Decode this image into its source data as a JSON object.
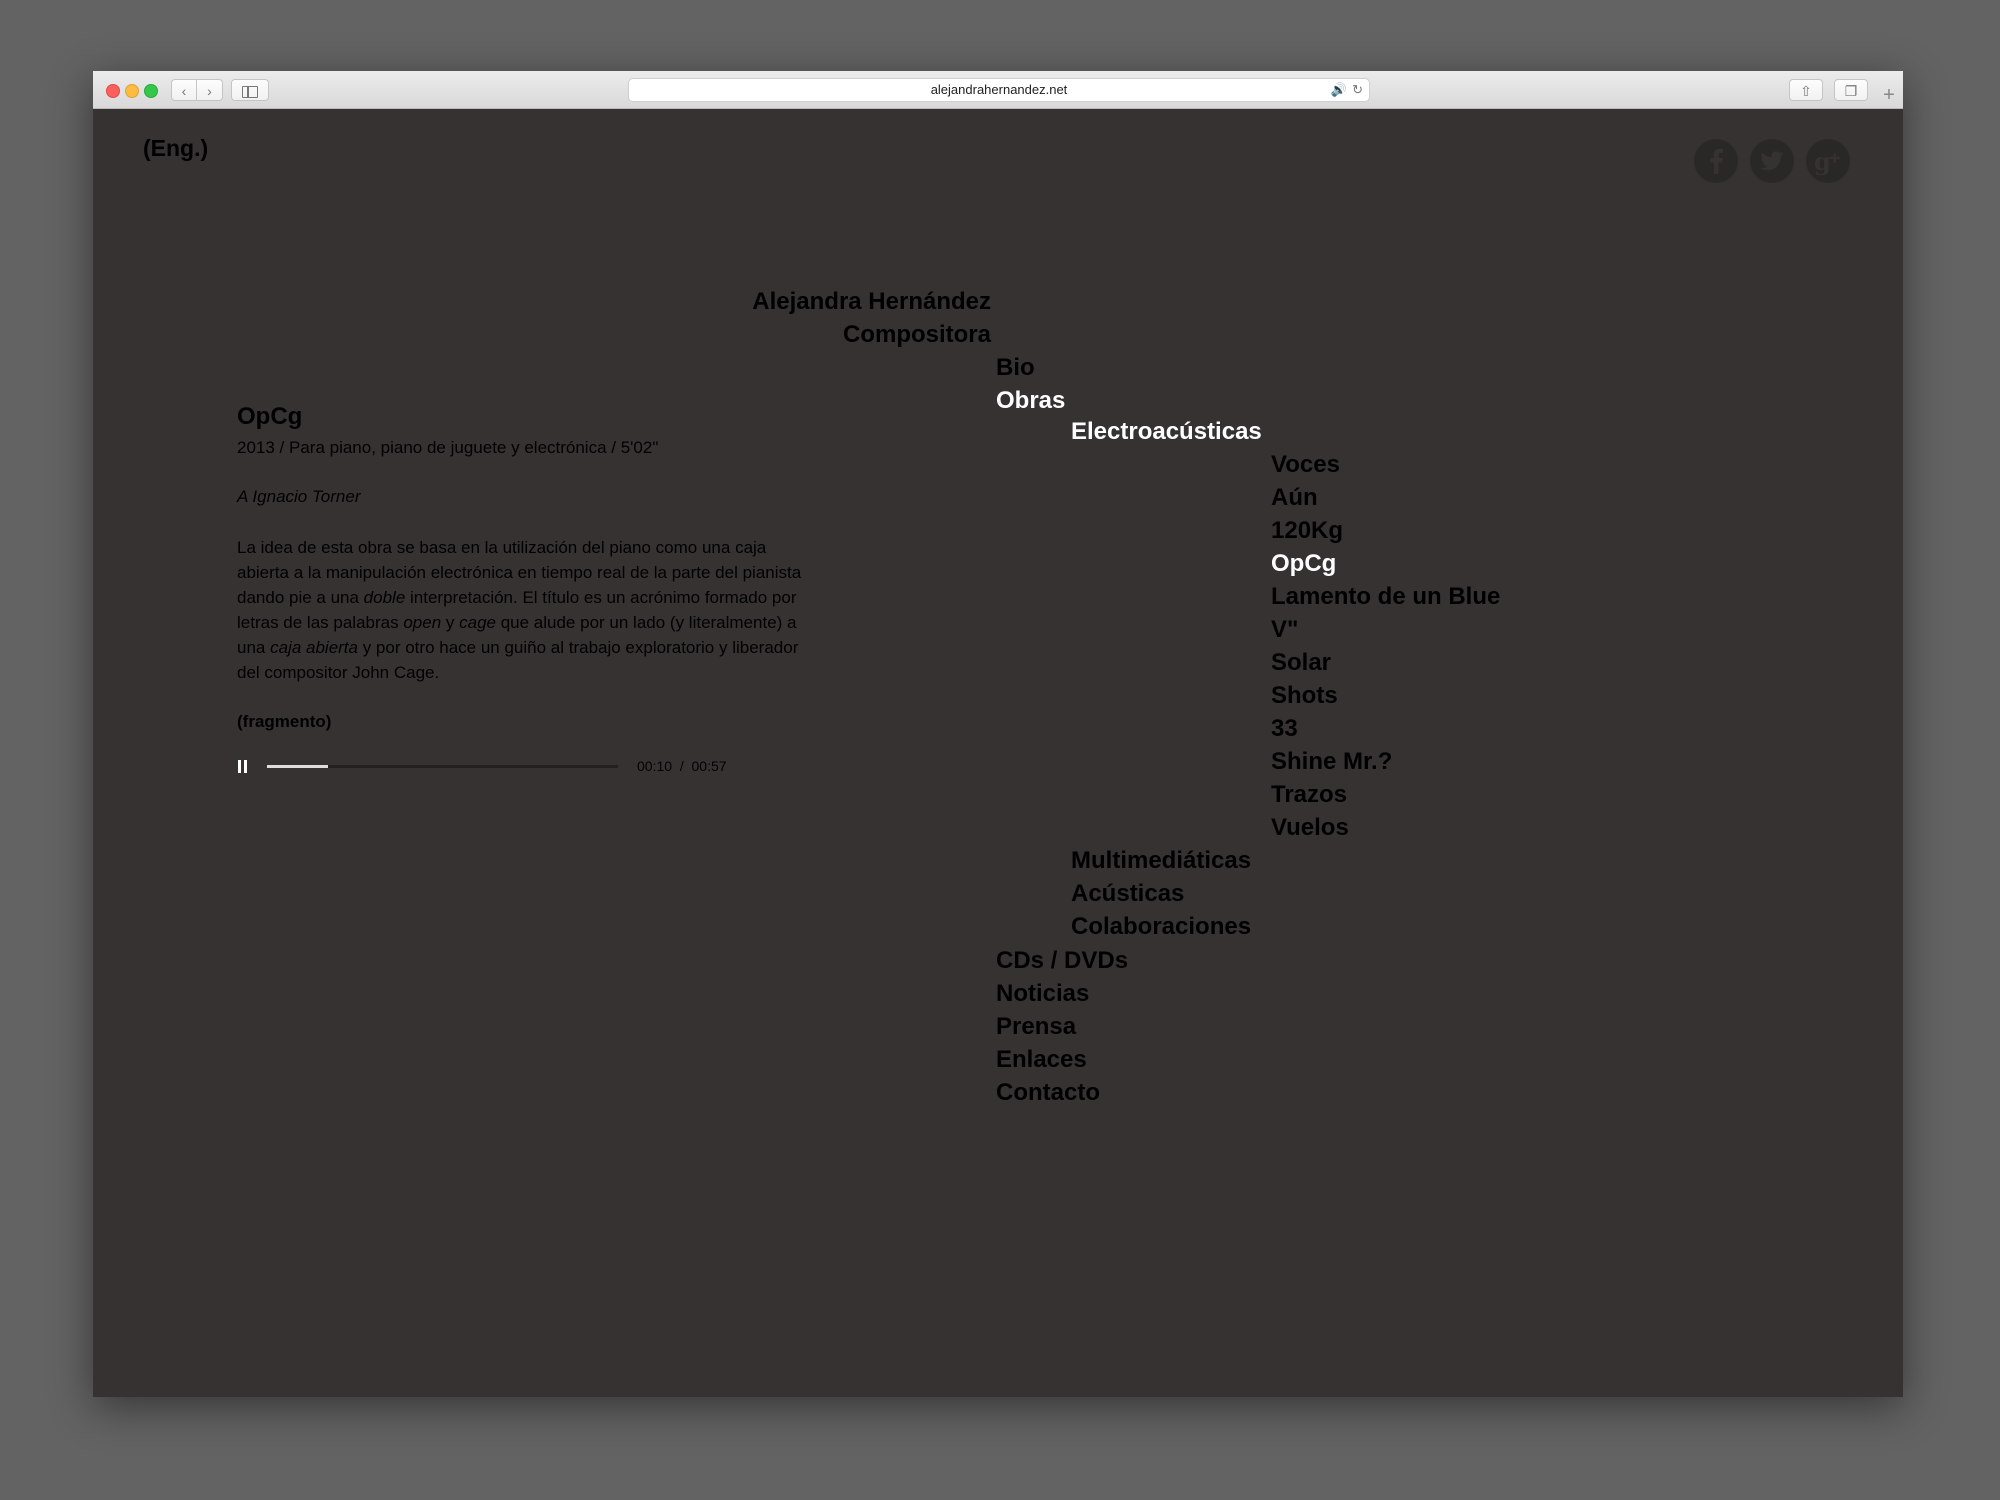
{
  "browser": {
    "url": "alejandrahernandez.net",
    "back_glyph": "‹",
    "forward_glyph": "›",
    "share_glyph": "⇧",
    "tabs_glyph": "❐",
    "new_tab_glyph": "+",
    "audio_glyph": "🔊",
    "reload_glyph": "↻"
  },
  "site": {
    "lang_link": "(Eng.)",
    "social": [
      "facebook-icon",
      "twitter-icon",
      "google-plus-icon"
    ],
    "name": "Alejandra Hernández",
    "role": "Compositora"
  },
  "nav": {
    "top": [
      "Bio",
      "Obras"
    ],
    "obras_sub": [
      "Electroacústicas",
      "Multimediáticas",
      "Acústicas",
      "Colaboraciones"
    ],
    "electro_works": [
      "Voces",
      "Aún",
      "120Kg",
      "OpCg",
      "Lamento de un Blue",
      "V\"",
      "Solar",
      "Shots",
      "33",
      "Shine Mr.?",
      "Trazos",
      "Vuelos"
    ],
    "bottom": [
      "CDs / DVDs",
      "Noticias",
      "Prensa",
      "Enlaces",
      "Contacto"
    ]
  },
  "work": {
    "title": "OpCg",
    "subtitle": "2013 / Para piano, piano de juguete y electrónica / 5'02\"",
    "dedication": "A Ignacio Torner",
    "desc": {
      "p1": "La idea de esta obra se basa en la utilización del piano como una caja abierta a la manipulación electrónica en tiempo real de la parte del pianista dando pie a una ",
      "em1": "doble",
      "p2": " interpretación. El título es un acrónimo formado por letras de las palabras ",
      "em2": "open",
      "p3": " y ",
      "em3": "cage",
      "p4": " que alude por un lado (y literalmente) a una ",
      "em4": "caja abierta",
      "p5": " y por otro hace un guiño al trabajo exploratorio y liberador del compositor John Cage."
    },
    "fragment_label": "(fragmento)"
  },
  "player": {
    "current": "00:10",
    "separator": "/",
    "duration": "00:57",
    "progress": 0.175
  }
}
